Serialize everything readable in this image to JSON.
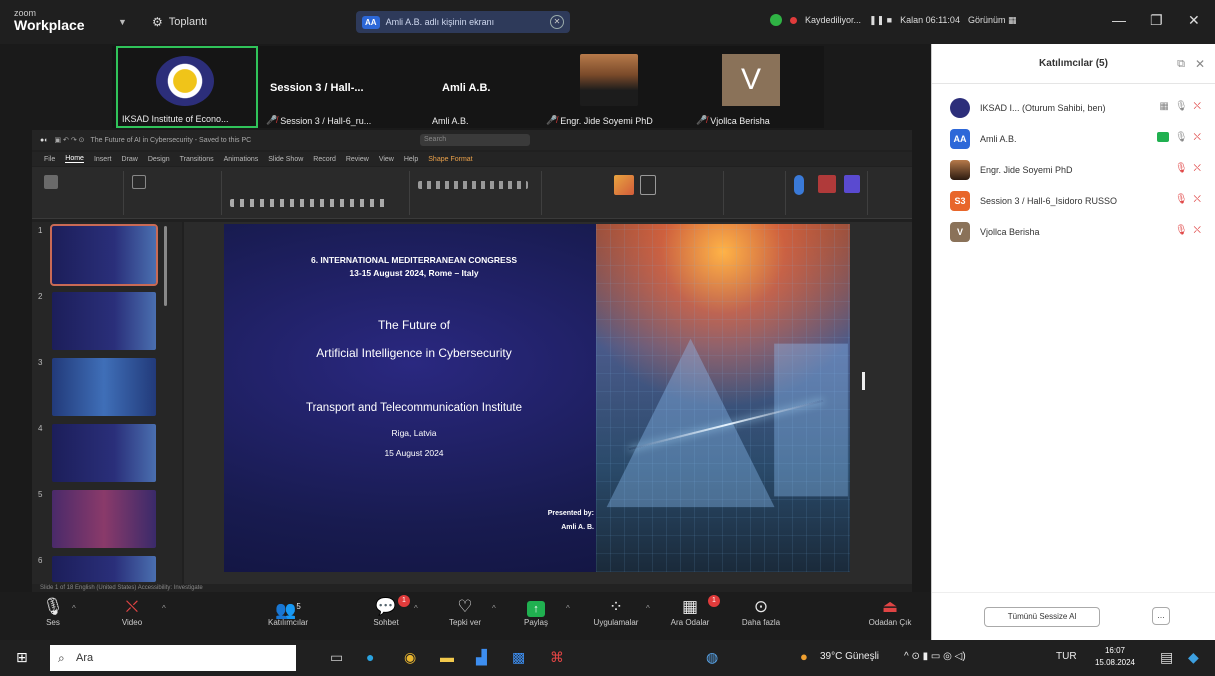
{
  "titlebar": {
    "brand_small": "zoom",
    "brand_big": "Workplace",
    "meeting_label": "Toplantı",
    "share_notice": "Amli A.B. adlı kişinin ekranı",
    "share_badge": "AA",
    "recording": "Kaydediliyor...",
    "duration": "Kalan 06:11:04",
    "view": "Görünüm"
  },
  "video_strip": {
    "tiles": [
      {
        "name": "IKSAD Institute of Econo..."
      },
      {
        "title": "Session 3 / Hall-...",
        "name": "Session 3 / Hall-6_ru..."
      },
      {
        "title": "Amli A.B.",
        "name": "Amli A.B."
      },
      {
        "name": "Engr. Jide Soyemi PhD"
      },
      {
        "avatar": "V",
        "name": "Vjollca Berisha"
      }
    ]
  },
  "powerpoint": {
    "title": "The Future of AI in Cybersecurity - Saved to this PC",
    "search_placeholder": "Search",
    "menu": [
      "File",
      "Home",
      "Insert",
      "Draw",
      "Design",
      "Transitions",
      "Animations",
      "Slide Show",
      "Record",
      "Review",
      "View",
      "Help",
      "Shape Format"
    ],
    "selected_menu": "Home",
    "thumb_numbers": [
      "1",
      "2",
      "3",
      "4",
      "5",
      "6"
    ],
    "status": "Slide 1 of 18   English (United States)   Accessibility: Investigate"
  },
  "slide": {
    "congress_line1": "6. INTERNATIONAL MEDITERRANEAN CONGRESS",
    "congress_line2": "13-15 August 2024, Rome – Italy",
    "main_line1": "The Future of",
    "main_line2": "Artificial Intelligence in Cybersecurity",
    "institute": "Transport and Telecommunication Institute",
    "city": "Riga, Latvia",
    "date": "15 August 2024",
    "presented_by": "Presented by:",
    "presenter": "Amli A. B."
  },
  "zoom_toolbar": {
    "buttons": [
      {
        "label": "Ses"
      },
      {
        "label": "Video"
      },
      {
        "label": "Katılımcılar",
        "count": "5"
      },
      {
        "label": "Sohbet",
        "badge": "1"
      },
      {
        "label": "Tepki ver"
      },
      {
        "label": "Paylaş"
      },
      {
        "label": "Uygulamalar"
      },
      {
        "label": "Ara Odalar",
        "badge": "1"
      },
      {
        "label": "Daha fazla"
      },
      {
        "label": "Odadan Çık"
      }
    ]
  },
  "participants": {
    "title": "Katılımcılar (5)",
    "rows": [
      {
        "name": "IKSAD I... (Oturum Sahibi, ben)",
        "avatar_color": "#2c2e7a",
        "initials": ""
      },
      {
        "name": "Amli A.B.",
        "avatar_color": "#2d68d8",
        "initials": "AA"
      },
      {
        "name": "Engr. Jide Soyemi PhD",
        "avatar_color": "#6b4a30",
        "initials": ""
      },
      {
        "name": "Session 3 / Hall-6_Isidoro RUSSO",
        "avatar_color": "#e8662a",
        "initials": "S3"
      },
      {
        "name": "Vjollca Berisha",
        "avatar_color": "#8a7259",
        "initials": "V"
      }
    ],
    "mute_all": "Tümünü Sessize Al",
    "more": "..."
  },
  "taskbar": {
    "search_placeholder": "Ara",
    "weather": "39°C Güneşli",
    "lang": "TUR",
    "time": "16:07",
    "date": "15.08.2024"
  }
}
